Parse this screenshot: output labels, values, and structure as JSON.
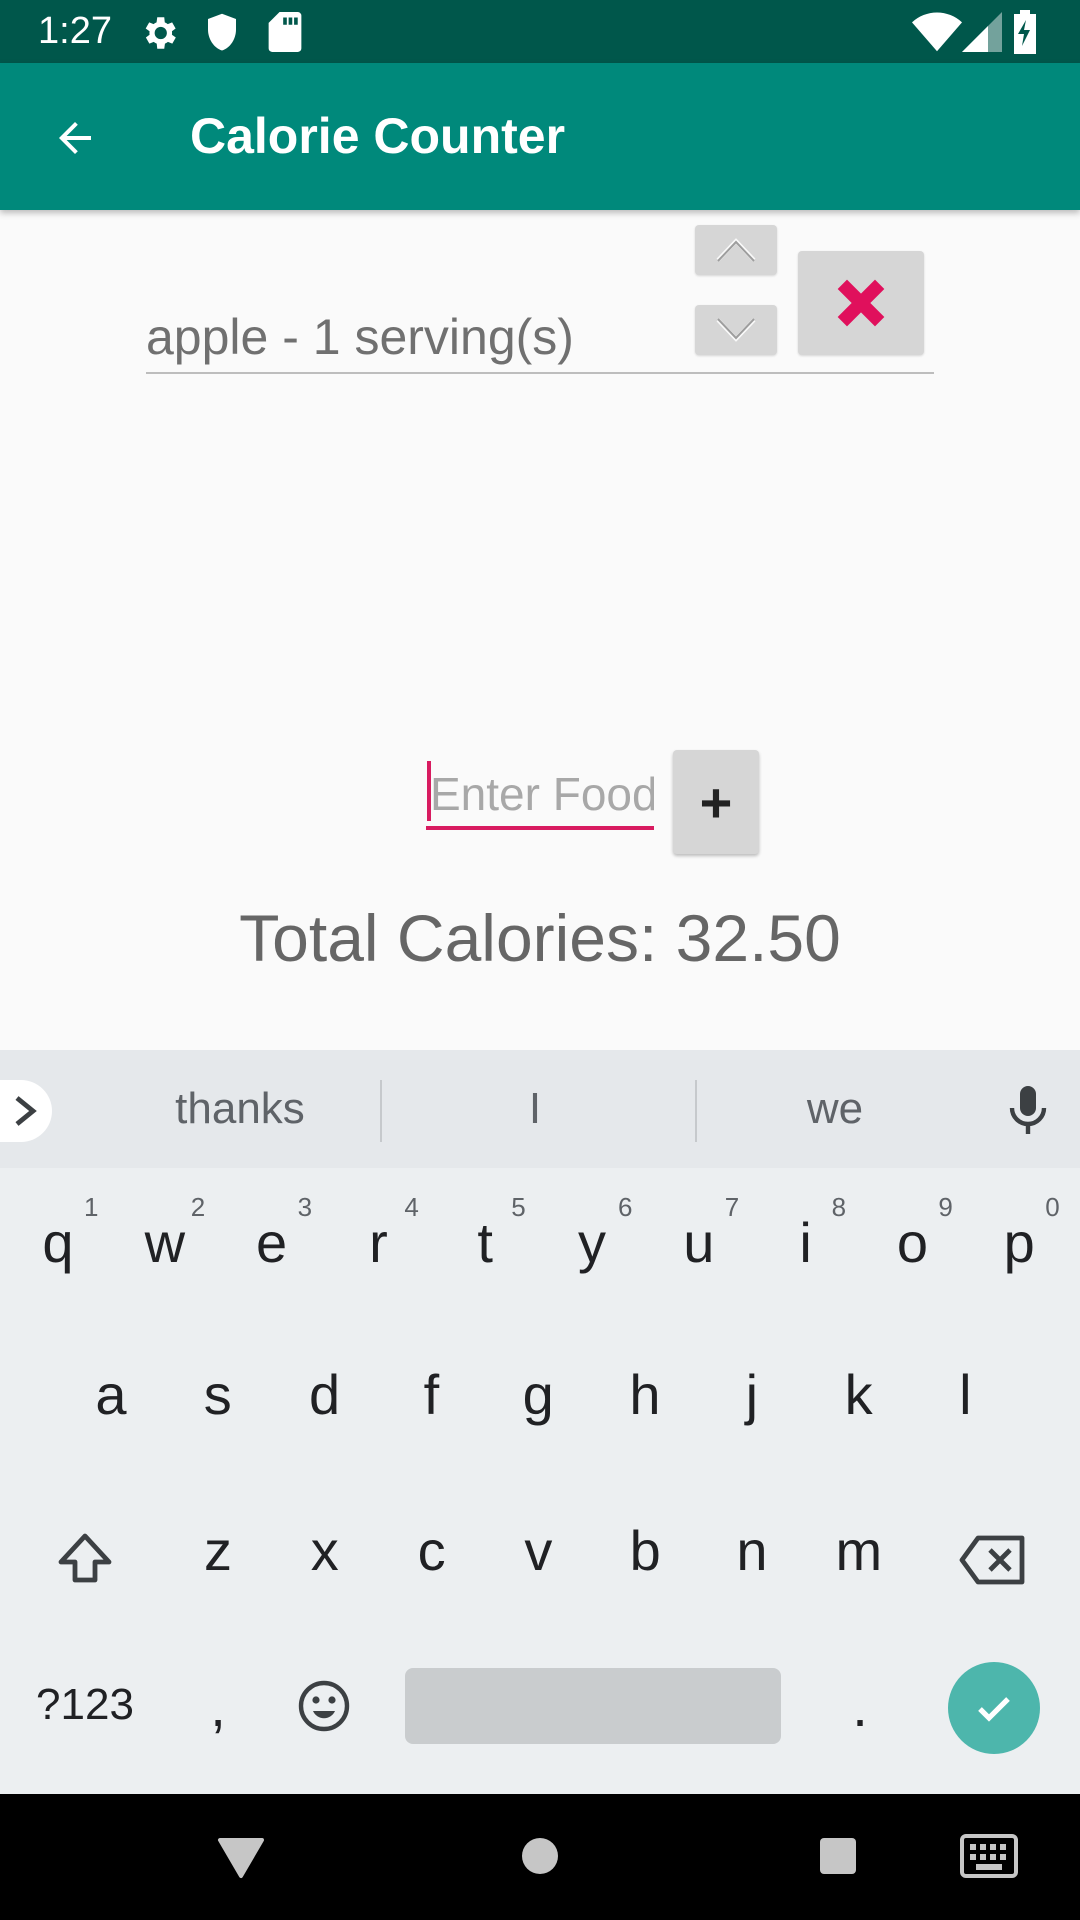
{
  "status": {
    "time": "1:27"
  },
  "app": {
    "title": "Calorie Counter"
  },
  "food_list": [
    {
      "label": "apple - 1 serving(s)"
    }
  ],
  "input": {
    "placeholder": "Enter Food",
    "value": "",
    "add_label": "+"
  },
  "total": {
    "text": "Total Calories: 32.50"
  },
  "keyboard": {
    "suggestions": [
      "thanks",
      "I",
      "we"
    ],
    "row1": [
      {
        "k": "q",
        "h": "1"
      },
      {
        "k": "w",
        "h": "2"
      },
      {
        "k": "e",
        "h": "3"
      },
      {
        "k": "r",
        "h": "4"
      },
      {
        "k": "t",
        "h": "5"
      },
      {
        "k": "y",
        "h": "6"
      },
      {
        "k": "u",
        "h": "7"
      },
      {
        "k": "i",
        "h": "8"
      },
      {
        "k": "o",
        "h": "9"
      },
      {
        "k": "p",
        "h": "0"
      }
    ],
    "row2": [
      "a",
      "s",
      "d",
      "f",
      "g",
      "h",
      "j",
      "k",
      "l"
    ],
    "row3": [
      "z",
      "x",
      "c",
      "v",
      "b",
      "n",
      "m"
    ],
    "symbols_label": "?123",
    "comma": ",",
    "period": "."
  },
  "colors": {
    "status_bar": "#00574b",
    "app_bar": "#00897b",
    "accent": "#d81b60",
    "enter_key": "#4db6ac"
  }
}
